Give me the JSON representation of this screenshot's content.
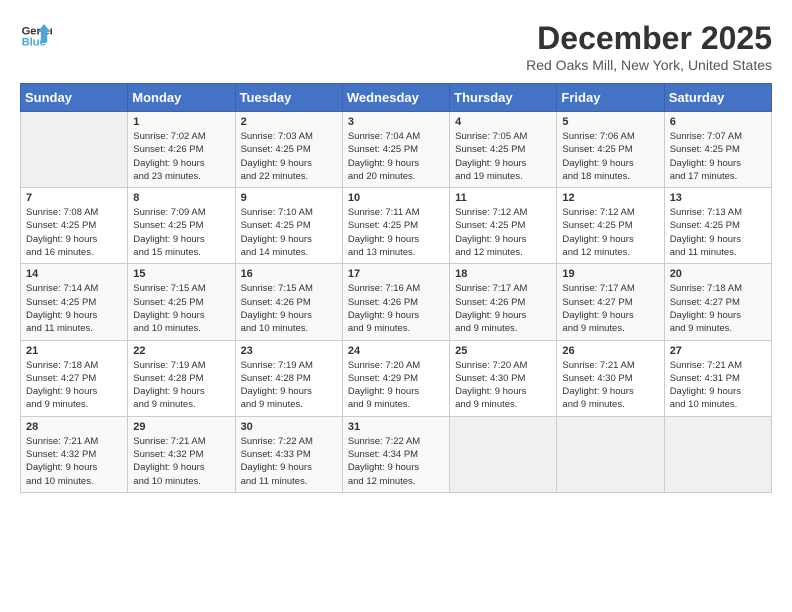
{
  "logo": {
    "line1": "General",
    "line2": "Blue"
  },
  "title": "December 2025",
  "location": "Red Oaks Mill, New York, United States",
  "days_header": [
    "Sunday",
    "Monday",
    "Tuesday",
    "Wednesday",
    "Thursday",
    "Friday",
    "Saturday"
  ],
  "weeks": [
    [
      {
        "day": "",
        "info": ""
      },
      {
        "day": "1",
        "info": "Sunrise: 7:02 AM\nSunset: 4:26 PM\nDaylight: 9 hours\nand 23 minutes."
      },
      {
        "day": "2",
        "info": "Sunrise: 7:03 AM\nSunset: 4:25 PM\nDaylight: 9 hours\nand 22 minutes."
      },
      {
        "day": "3",
        "info": "Sunrise: 7:04 AM\nSunset: 4:25 PM\nDaylight: 9 hours\nand 20 minutes."
      },
      {
        "day": "4",
        "info": "Sunrise: 7:05 AM\nSunset: 4:25 PM\nDaylight: 9 hours\nand 19 minutes."
      },
      {
        "day": "5",
        "info": "Sunrise: 7:06 AM\nSunset: 4:25 PM\nDaylight: 9 hours\nand 18 minutes."
      },
      {
        "day": "6",
        "info": "Sunrise: 7:07 AM\nSunset: 4:25 PM\nDaylight: 9 hours\nand 17 minutes."
      }
    ],
    [
      {
        "day": "7",
        "info": "Sunrise: 7:08 AM\nSunset: 4:25 PM\nDaylight: 9 hours\nand 16 minutes."
      },
      {
        "day": "8",
        "info": "Sunrise: 7:09 AM\nSunset: 4:25 PM\nDaylight: 9 hours\nand 15 minutes."
      },
      {
        "day": "9",
        "info": "Sunrise: 7:10 AM\nSunset: 4:25 PM\nDaylight: 9 hours\nand 14 minutes."
      },
      {
        "day": "10",
        "info": "Sunrise: 7:11 AM\nSunset: 4:25 PM\nDaylight: 9 hours\nand 13 minutes."
      },
      {
        "day": "11",
        "info": "Sunrise: 7:12 AM\nSunset: 4:25 PM\nDaylight: 9 hours\nand 12 minutes."
      },
      {
        "day": "12",
        "info": "Sunrise: 7:12 AM\nSunset: 4:25 PM\nDaylight: 9 hours\nand 12 minutes."
      },
      {
        "day": "13",
        "info": "Sunrise: 7:13 AM\nSunset: 4:25 PM\nDaylight: 9 hours\nand 11 minutes."
      }
    ],
    [
      {
        "day": "14",
        "info": "Sunrise: 7:14 AM\nSunset: 4:25 PM\nDaylight: 9 hours\nand 11 minutes."
      },
      {
        "day": "15",
        "info": "Sunrise: 7:15 AM\nSunset: 4:25 PM\nDaylight: 9 hours\nand 10 minutes."
      },
      {
        "day": "16",
        "info": "Sunrise: 7:15 AM\nSunset: 4:26 PM\nDaylight: 9 hours\nand 10 minutes."
      },
      {
        "day": "17",
        "info": "Sunrise: 7:16 AM\nSunset: 4:26 PM\nDaylight: 9 hours\nand 9 minutes."
      },
      {
        "day": "18",
        "info": "Sunrise: 7:17 AM\nSunset: 4:26 PM\nDaylight: 9 hours\nand 9 minutes."
      },
      {
        "day": "19",
        "info": "Sunrise: 7:17 AM\nSunset: 4:27 PM\nDaylight: 9 hours\nand 9 minutes."
      },
      {
        "day": "20",
        "info": "Sunrise: 7:18 AM\nSunset: 4:27 PM\nDaylight: 9 hours\nand 9 minutes."
      }
    ],
    [
      {
        "day": "21",
        "info": "Sunrise: 7:18 AM\nSunset: 4:27 PM\nDaylight: 9 hours\nand 9 minutes."
      },
      {
        "day": "22",
        "info": "Sunrise: 7:19 AM\nSunset: 4:28 PM\nDaylight: 9 hours\nand 9 minutes."
      },
      {
        "day": "23",
        "info": "Sunrise: 7:19 AM\nSunset: 4:28 PM\nDaylight: 9 hours\nand 9 minutes."
      },
      {
        "day": "24",
        "info": "Sunrise: 7:20 AM\nSunset: 4:29 PM\nDaylight: 9 hours\nand 9 minutes."
      },
      {
        "day": "25",
        "info": "Sunrise: 7:20 AM\nSunset: 4:30 PM\nDaylight: 9 hours\nand 9 minutes."
      },
      {
        "day": "26",
        "info": "Sunrise: 7:21 AM\nSunset: 4:30 PM\nDaylight: 9 hours\nand 9 minutes."
      },
      {
        "day": "27",
        "info": "Sunrise: 7:21 AM\nSunset: 4:31 PM\nDaylight: 9 hours\nand 10 minutes."
      }
    ],
    [
      {
        "day": "28",
        "info": "Sunrise: 7:21 AM\nSunset: 4:32 PM\nDaylight: 9 hours\nand 10 minutes."
      },
      {
        "day": "29",
        "info": "Sunrise: 7:21 AM\nSunset: 4:32 PM\nDaylight: 9 hours\nand 10 minutes."
      },
      {
        "day": "30",
        "info": "Sunrise: 7:22 AM\nSunset: 4:33 PM\nDaylight: 9 hours\nand 11 minutes."
      },
      {
        "day": "31",
        "info": "Sunrise: 7:22 AM\nSunset: 4:34 PM\nDaylight: 9 hours\nand 12 minutes."
      },
      {
        "day": "",
        "info": ""
      },
      {
        "day": "",
        "info": ""
      },
      {
        "day": "",
        "info": ""
      }
    ]
  ]
}
